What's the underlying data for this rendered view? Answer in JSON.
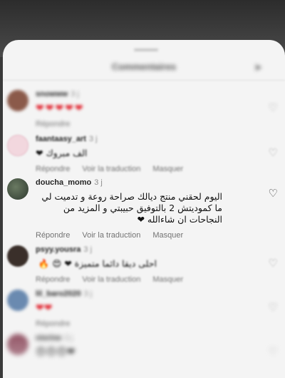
{
  "sheet": {
    "title": "Commentaires"
  },
  "comments": [
    {
      "username": "snowww",
      "time": "3 j",
      "text": "❤❤❤❤❤",
      "actions": [
        "Répondre"
      ],
      "avatar_color": "#8b5a4a"
    },
    {
      "username": "faantaasy_art",
      "time": "3 j",
      "text": "الف مبروك ❤",
      "actions": [
        "Répondre",
        "Voir la traduction",
        "Masquer"
      ],
      "avatar_color": "#f2d7de"
    },
    {
      "username": "doucha_momo",
      "time": "3 j",
      "text": "اليوم لحقني منتج ديالك صراحة روعة و تدميت لي ما كموديتش 2 بالتوفيق حبيبتي و المزيد من النجاحات ان شاءالله ❤",
      "actions": [
        "Répondre",
        "Voir la traduction",
        "Masquer"
      ],
      "avatar_color": "#4a5a4a"
    },
    {
      "username": "psyy.yousra",
      "time": "3 j",
      "text": "احلى ديقا دائما متميزة ❤ 😍 🔥",
      "actions": [
        "Répondre",
        "Voir la traduction",
        "Masquer"
      ],
      "avatar_color": "#3a2f2a"
    },
    {
      "username": "lil_baro2020",
      "time": "3 j",
      "text": "❤❤",
      "actions": [
        "Répondre"
      ],
      "avatar_color": "#6a8ab0"
    },
    {
      "username": "nisrine",
      "time": "3 j",
      "text": "😍😍😍❤",
      "actions": [],
      "avatar_color": "#9a6070"
    }
  ]
}
